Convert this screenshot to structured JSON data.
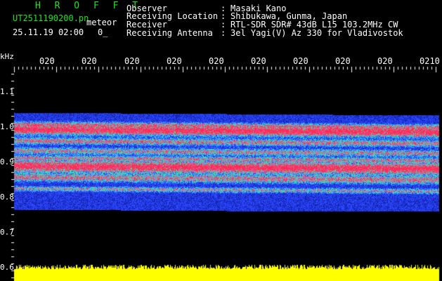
{
  "header": {
    "app_title": "H R O F F T",
    "filename": "UT2511190200.pn",
    "meteor_label": "meteor",
    "date_time": "25.11.19 02:00",
    "count": "0_"
  },
  "info": [
    {
      "label": "Observer",
      "sep": ":",
      "value": "Masaki Kano"
    },
    {
      "label": "Receiving Location",
      "sep": ":",
      "value": "Shibukawa, Gunma, Japan"
    },
    {
      "label": "Receiver",
      "sep": ":",
      "value": "RTL-SDR SDR# 43dB L15 103.2MHz CW"
    },
    {
      "label": "Receiving Antenna",
      "sep": ":",
      "value": "3el Yagi(V) Az 330 for Vladivostok"
    }
  ],
  "axis": {
    "y_unit": "kHz",
    "y_ticks": [
      "1.1",
      "1.0",
      "0.9",
      "0.8",
      "0.7",
      "0.6"
    ],
    "x_ticks": [
      "020",
      "020",
      "020",
      "020",
      "020",
      "020",
      "020",
      "020",
      "020",
      "0210"
    ]
  },
  "colors": {
    "background": "#000000",
    "header_green": "#19e619",
    "text": "#ffffff",
    "signal_red": "#ff2050",
    "noise_blue": "#1a2cff",
    "power_yellow": "#ffff00"
  }
}
